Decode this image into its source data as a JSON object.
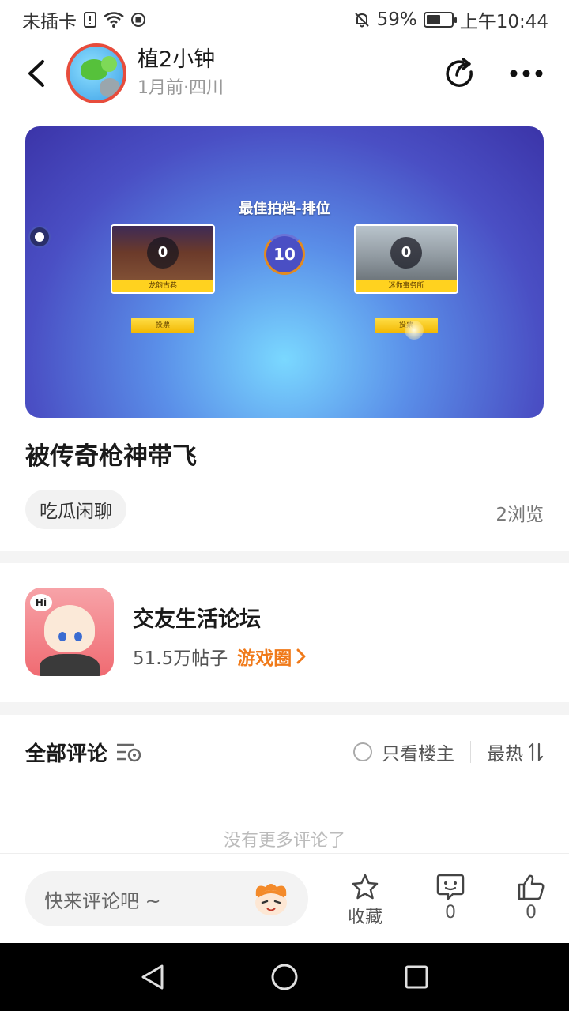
{
  "status_bar": {
    "carrier": "未插卡",
    "battery_percent": "59%",
    "battery_level": 0.59,
    "time": "上午10:44"
  },
  "header": {
    "author_name": "植2小钟",
    "meta": "1月前·四川"
  },
  "media": {
    "title": "最佳拍档-排位",
    "left_map": {
      "score": "0",
      "label": "龙韵古巷"
    },
    "right_map": {
      "score": "0",
      "label": "迷你事务所"
    },
    "timer": "10",
    "vote_left": "投票",
    "vote_right": "投票"
  },
  "post": {
    "title": "被传奇枪神带飞",
    "tag": "吃瓜闲聊",
    "views": "2浏览"
  },
  "forum": {
    "name": "交友生活论坛",
    "posts": "51.5万帖子",
    "link": "游戏圈",
    "badge": "Hi"
  },
  "comments": {
    "title": "全部评论",
    "only_op": "只看楼主",
    "sort": "最热",
    "empty": "没有更多评论了"
  },
  "bottom_bar": {
    "input_placeholder": "快来评论吧 ~",
    "favorite_label": "收藏",
    "comment_count": "0",
    "like_count": "0"
  },
  "colors": {
    "accent_orange": "#f07a1a",
    "text_primary": "#1a1a1a",
    "text_secondary": "#999999"
  },
  "icons": {
    "back": "chevron-left-icon",
    "share": "share-icon",
    "more": "more-dots-icon",
    "favorite": "star-icon",
    "comment": "comment-bubble-icon",
    "like": "thumbs-up-icon"
  }
}
